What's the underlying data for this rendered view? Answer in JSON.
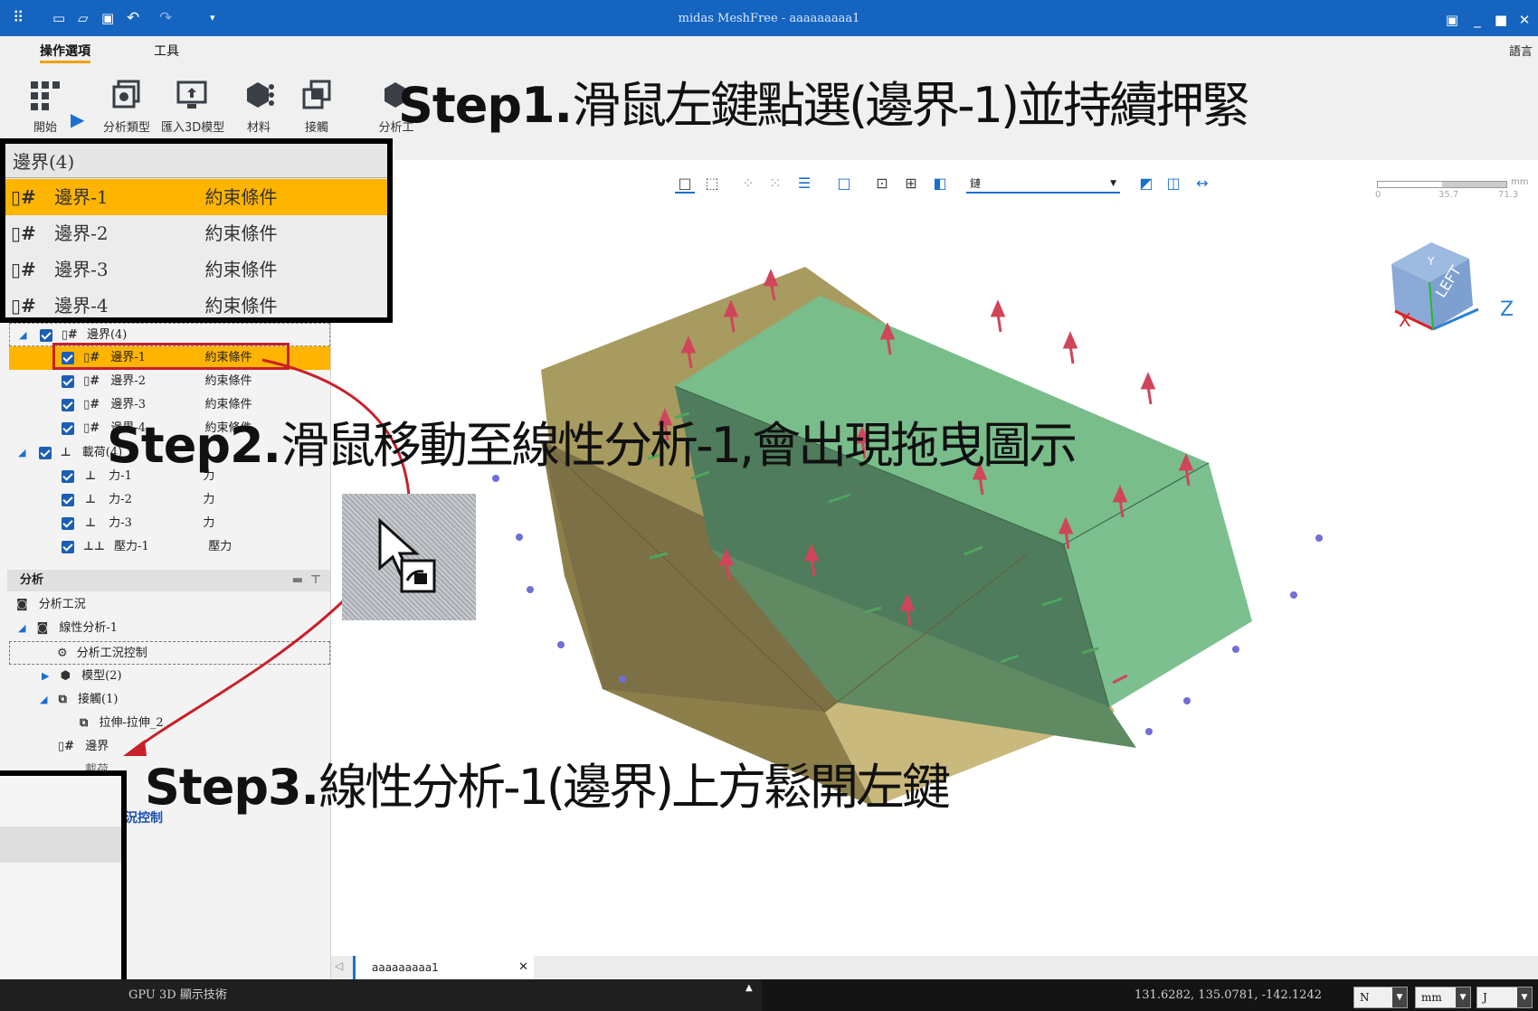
{
  "window": {
    "title": "midas MeshFree - aaaaaaaaa1",
    "language_label": "語言"
  },
  "ribbon": {
    "tabs": [
      {
        "label": "操作選項"
      },
      {
        "label": "工具"
      }
    ],
    "buttons": [
      {
        "label": "開始",
        "icon": "grid-icon"
      },
      {
        "label": "分析類型",
        "icon": "cube-stack-icon"
      },
      {
        "label": "匯入3D模型",
        "icon": "import-model-icon"
      },
      {
        "label": "材料",
        "icon": "material-icon"
      },
      {
        "label": "接觸",
        "icon": "contact-icon"
      },
      {
        "label": "分析工",
        "icon": "analysis-icon"
      }
    ]
  },
  "steps": {
    "step1_prefix": "Step1.",
    "step1_text": "滑鼠左鍵點選(邊界-1)並持續押緊",
    "step2_prefix": "Step2.",
    "step2_text": "滑鼠移動至線性分析-1,會出現拖曳圖示",
    "step3_prefix": "Step3.",
    "step3_text": "線性分析-1(邊界)上方鬆開左鍵"
  },
  "zoom_popup": {
    "header": "邊界(4)",
    "rows": [
      {
        "name": "邊界-1",
        "type": "約束條件",
        "selected": true
      },
      {
        "name": "邊界-2",
        "type": "約束條件",
        "selected": false
      },
      {
        "name": "邊界-3",
        "type": "約束條件",
        "selected": false
      },
      {
        "name": "邊界-4",
        "type": "約束條件",
        "selected": false
      }
    ]
  },
  "tree": {
    "boundary_group": "邊界(4)",
    "boundaries": [
      {
        "name": "邊界-1",
        "type": "約束條件"
      },
      {
        "name": "邊界-2",
        "type": "約束條件"
      },
      {
        "name": "邊界-3",
        "type": "約束條件"
      },
      {
        "name": "邊界-4",
        "type": "約束條件"
      }
    ],
    "load_group": "載荷(4)",
    "loads": [
      {
        "name": "力-1",
        "type": "力"
      },
      {
        "name": "力-2",
        "type": "力"
      },
      {
        "name": "力-3",
        "type": "力"
      },
      {
        "name": "壓力-1",
        "type": "壓力"
      }
    ],
    "analysis_header": "分析",
    "analysis_case": "分析工況",
    "linear_analysis": "線性分析-1",
    "case_control": "分析工況控制",
    "model": "模型(2)",
    "contact": "接觸(1)",
    "contact_item": "拉伸-拉伸_2",
    "boundary_node": "邊界",
    "load_node": "載荷",
    "bottom_link": "況控制"
  },
  "viewport": {
    "filter_select": "鏈",
    "scale_unit": "mm",
    "scale_ticks": [
      "0",
      "35.7",
      "71.3"
    ],
    "cube_face": "LEFT",
    "axis_z": "Z",
    "axis_x": "X",
    "axis_y": "Y",
    "doc_tab": "aaaaaaaaa1"
  },
  "status": {
    "gpu_text": "GPU 3D 顯示技術",
    "coords": "131.6282, 135.0781, -142.1242",
    "force_unit": "N",
    "length_unit": "mm",
    "energy_unit": "J"
  },
  "colors": {
    "titlebar": "#1464c0",
    "selection": "#ffb400",
    "box_green": "#6fbb86",
    "box_tan": "#c8b97a",
    "arrow_red": "#c0392b"
  }
}
